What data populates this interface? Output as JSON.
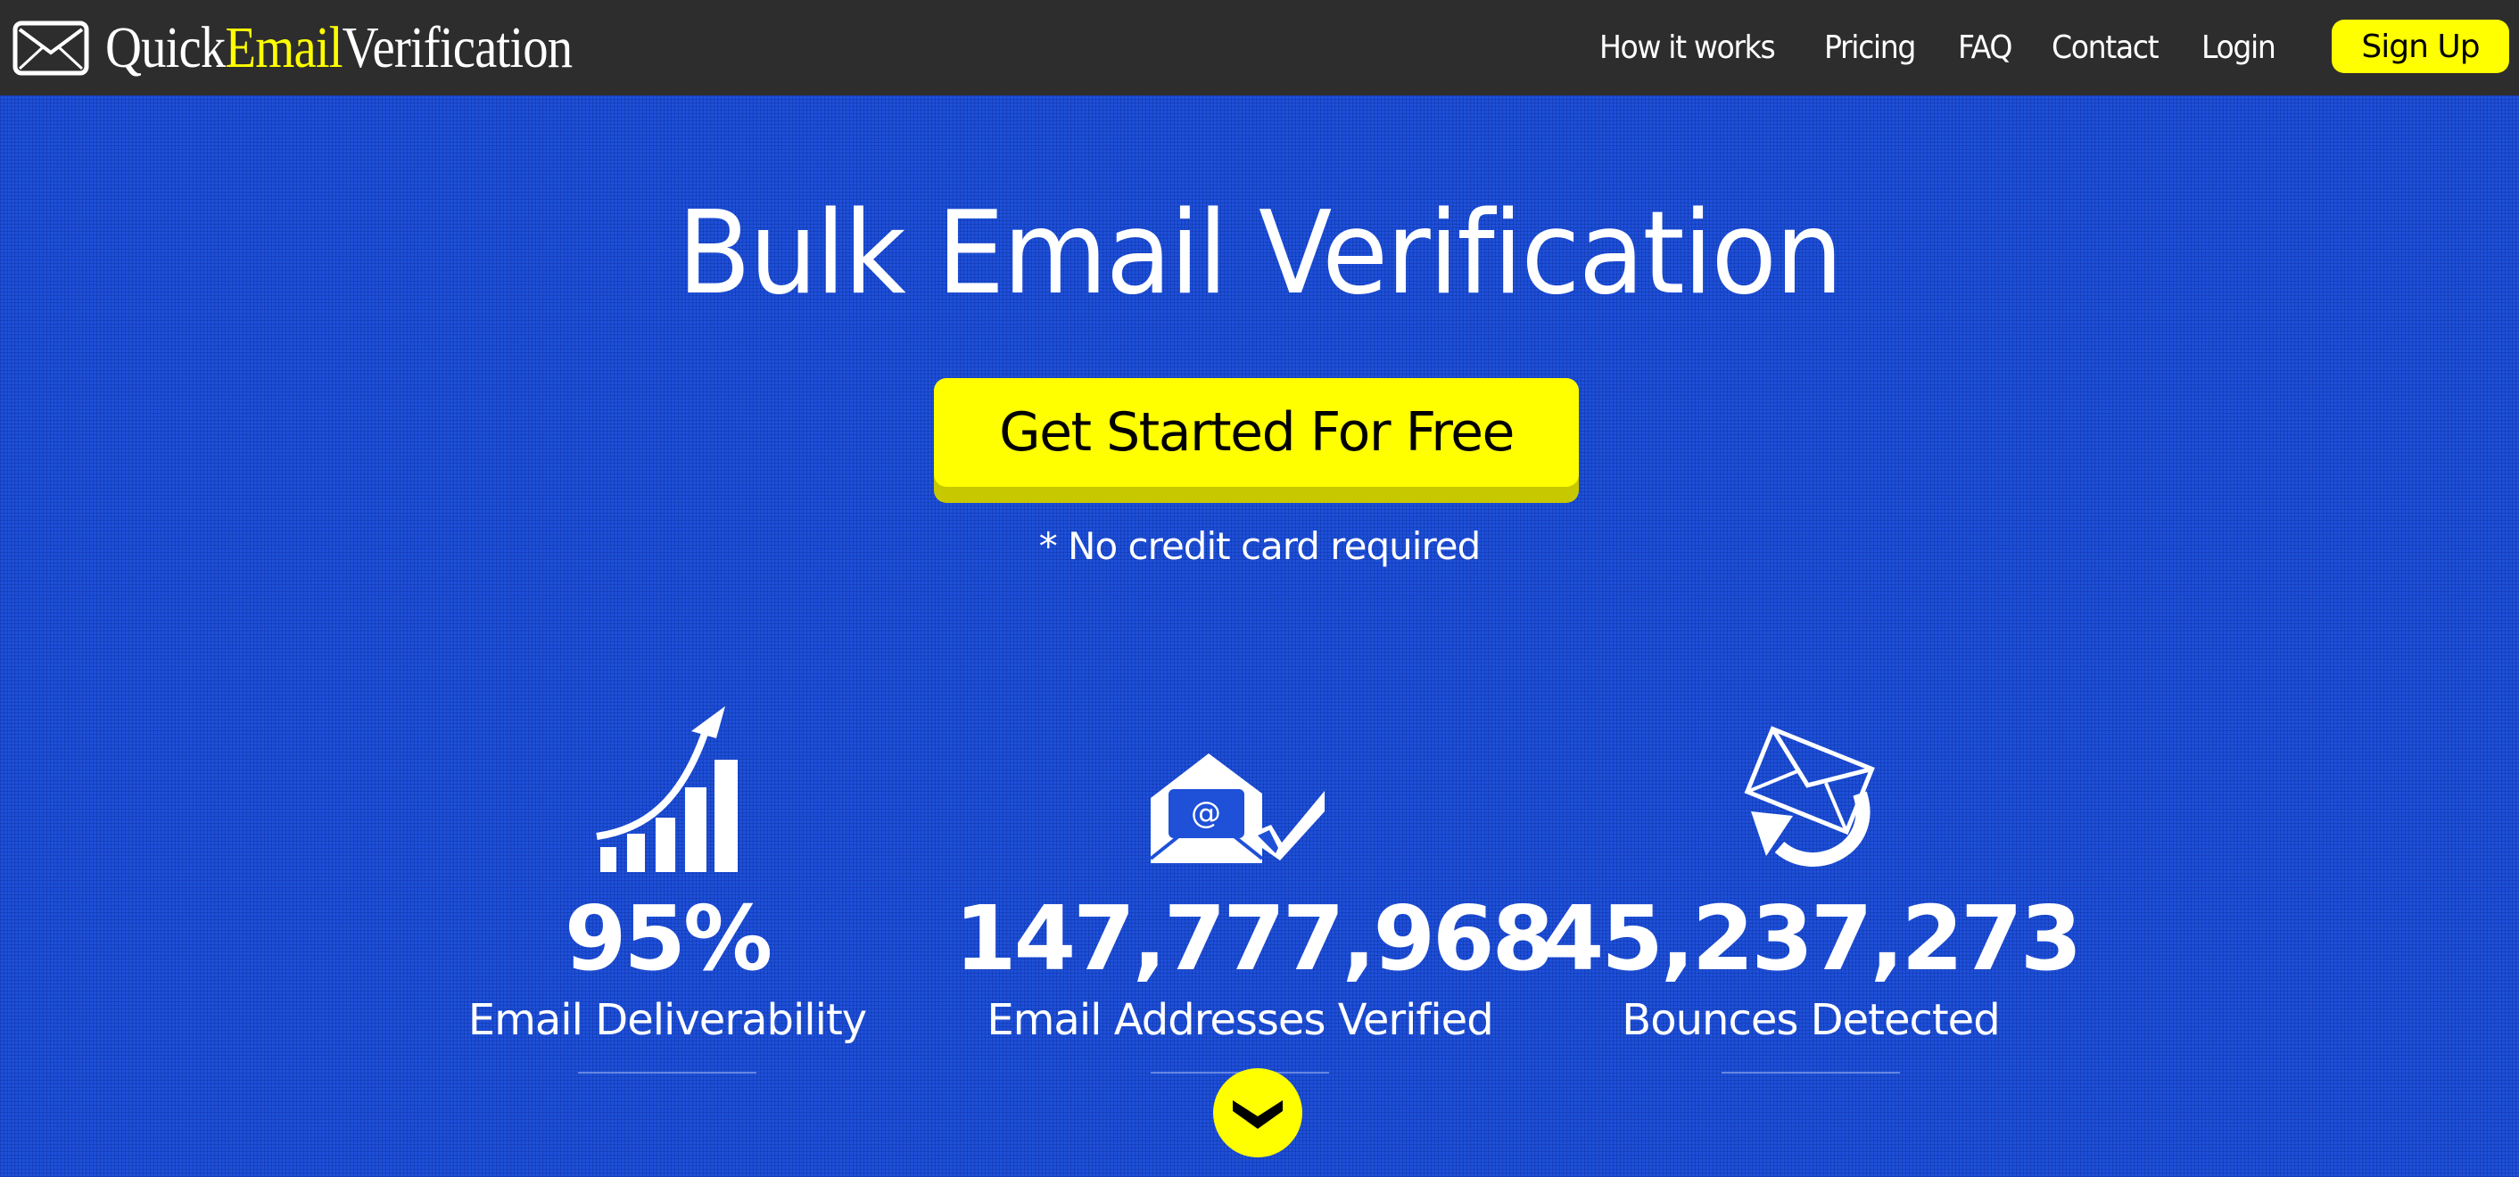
{
  "header": {
    "logo": {
      "part1": "Quick",
      "part2": "Email",
      "part3": "Verification",
      "icon": "envelope-icon"
    },
    "nav": [
      {
        "label": "How it works"
      },
      {
        "label": "Pricing"
      },
      {
        "label": "FAQ"
      },
      {
        "label": "Contact"
      },
      {
        "label": "Login"
      }
    ],
    "signup_label": "Sign Up"
  },
  "hero": {
    "title": "Bulk Email Verification",
    "cta_label": "Get Started For Free",
    "note": "* No credit card required"
  },
  "stats": [
    {
      "icon": "growth-chart-icon",
      "value": "95%",
      "label": "Email Deliverability"
    },
    {
      "icon": "verified-email-icon",
      "value": "147,777,968",
      "label": "Email Addresses Verified"
    },
    {
      "icon": "bounce-email-icon",
      "value": "45,237,273",
      "label": "Bounces Detected"
    }
  ],
  "scroll_down": {
    "icon": "chevron-down-icon"
  },
  "colors": {
    "header_bg": "#2d2d2d",
    "hero_bg": "#1e50d8",
    "accent": "#ffff00"
  }
}
